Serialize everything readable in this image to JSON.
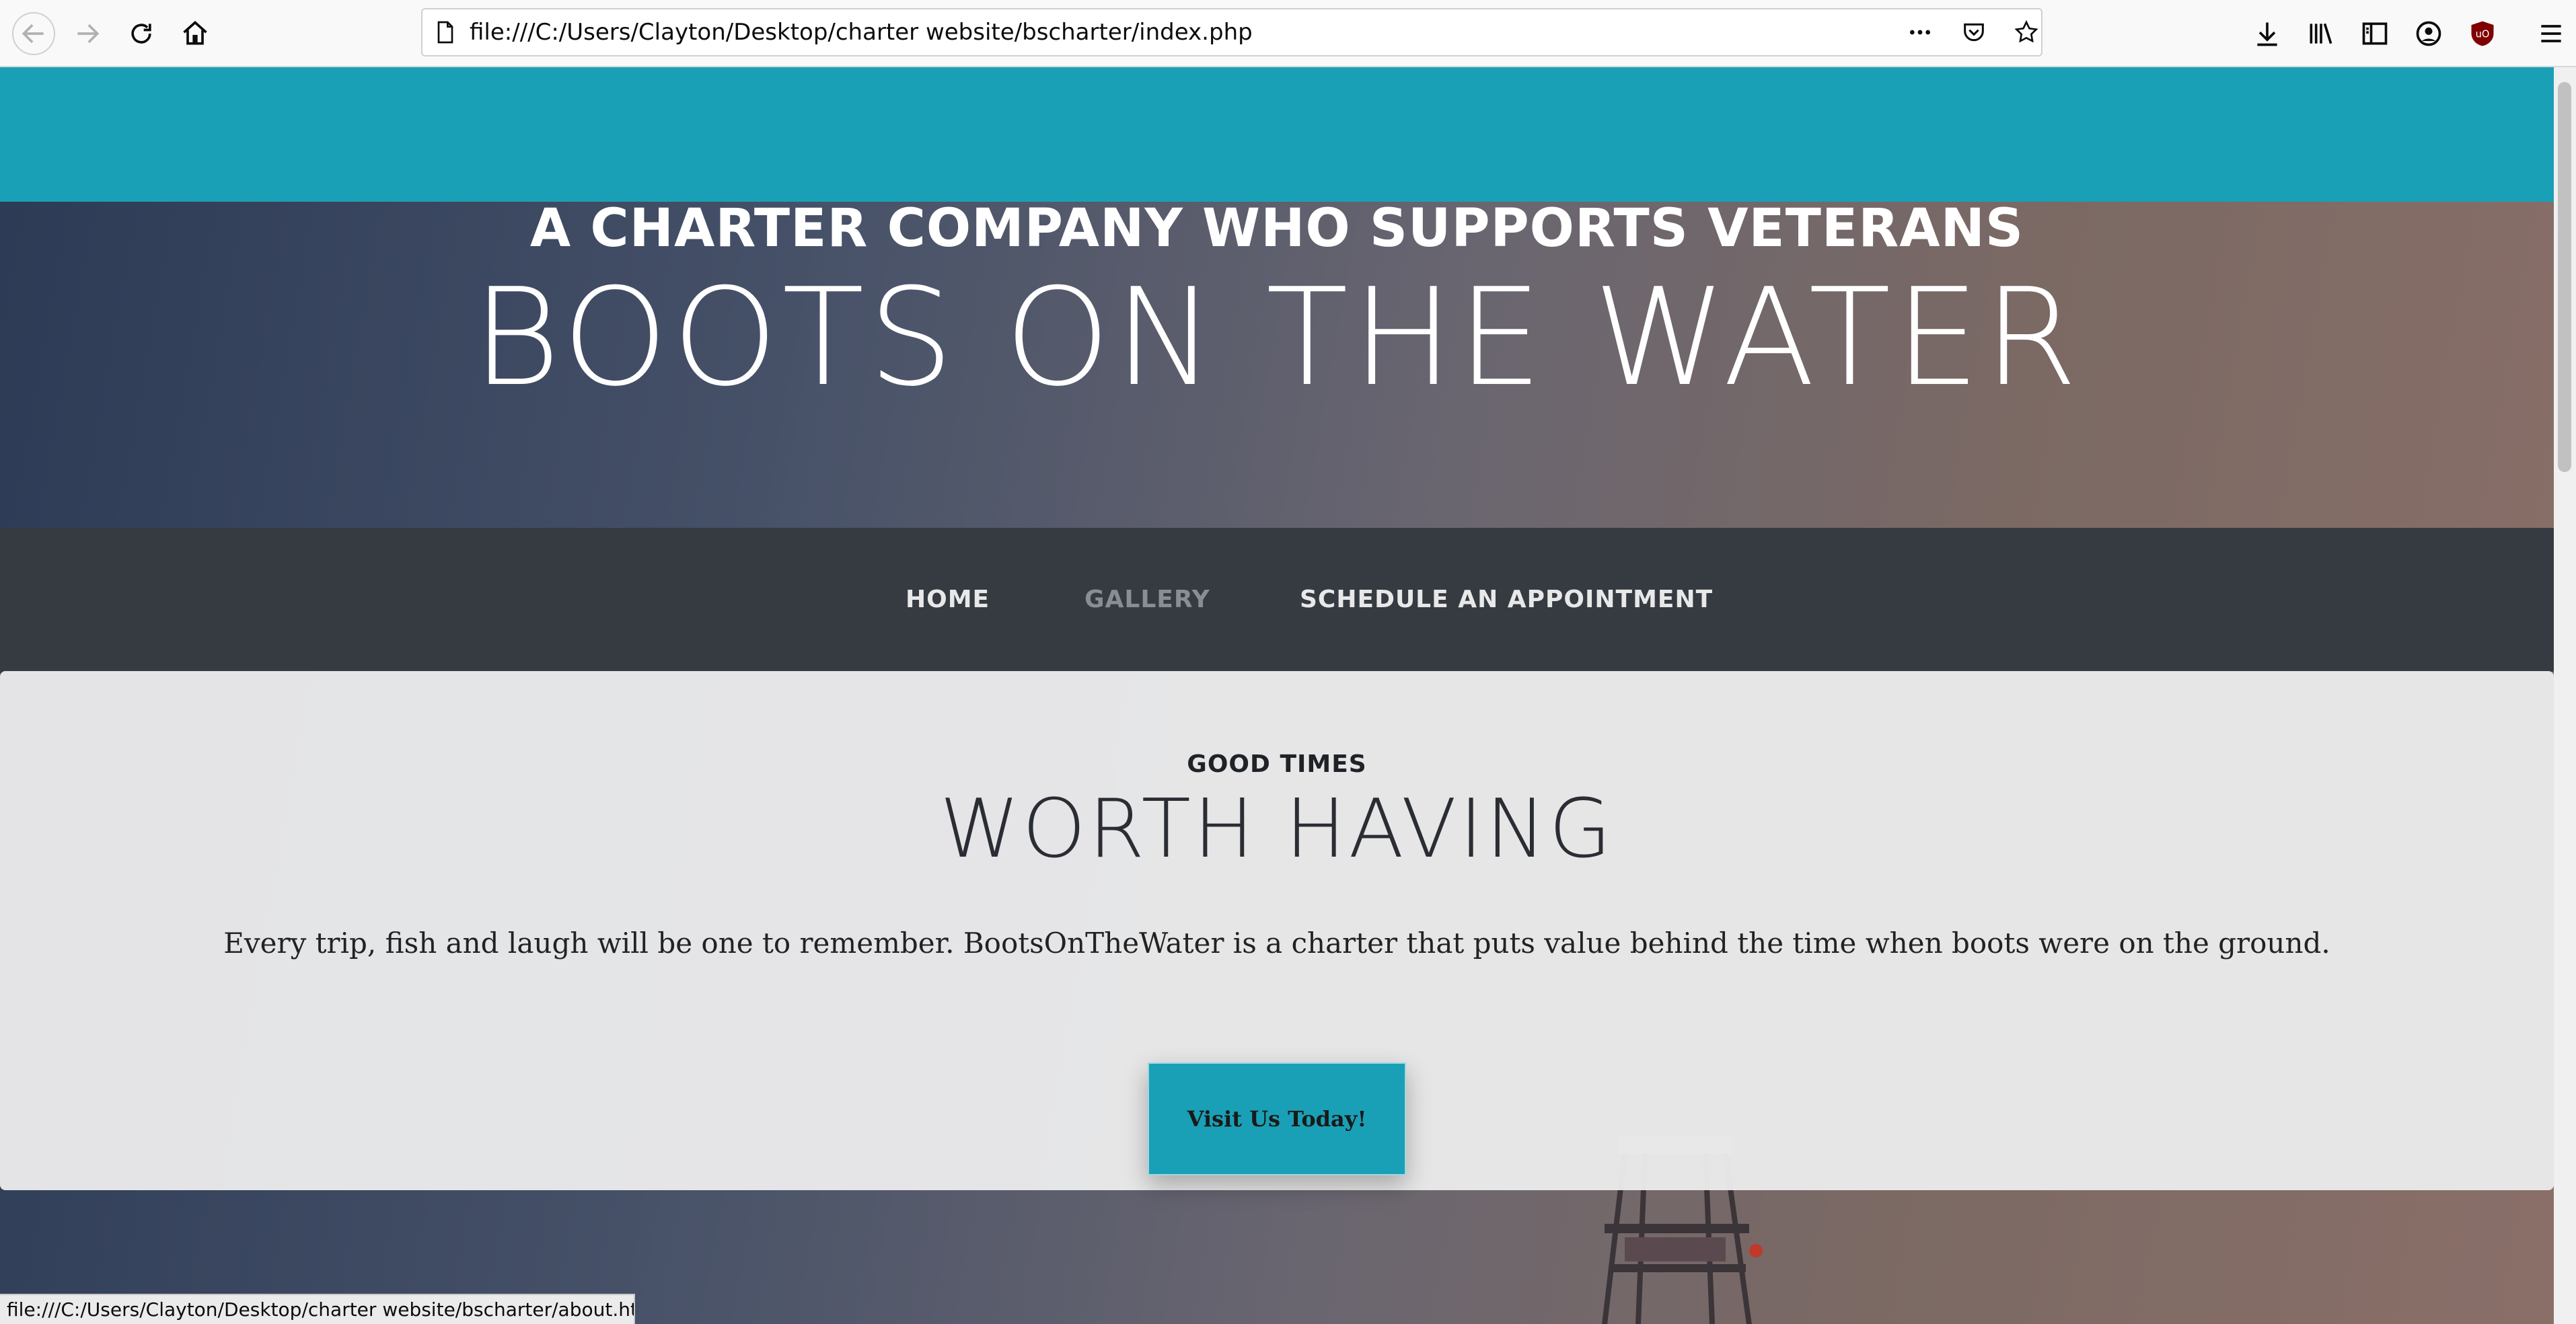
{
  "browser": {
    "url": "file:///C:/Users/Clayton/Desktop/charter website/bscharter/index.php",
    "status_url": "file:///C:/Users/Clayton/Desktop/charter website/bscharter/about.html"
  },
  "hero": {
    "subtitle": "A CHARTER COMPANY WHO SUPPORTS VETERANS",
    "title": "BOOTS ON THE WATER"
  },
  "nav": {
    "items": [
      {
        "label": "HOME"
      },
      {
        "label": "GALLERY"
      },
      {
        "label": "SCHEDULE AN APPOINTMENT"
      }
    ]
  },
  "intro": {
    "subtitle": "GOOD TIMES",
    "title": "WORTH HAVING",
    "text": "Every trip, fish and laugh will be one to remember. BootsOnTheWater is a charter that puts value behind the time when boots were on the ground.",
    "button": "Visit Us Today!"
  },
  "colors": {
    "accent": "#19a0b6",
    "nav_bg": "#363b42",
    "nav_text": "#e8e8e8",
    "nav_active": "#8a8e94"
  }
}
